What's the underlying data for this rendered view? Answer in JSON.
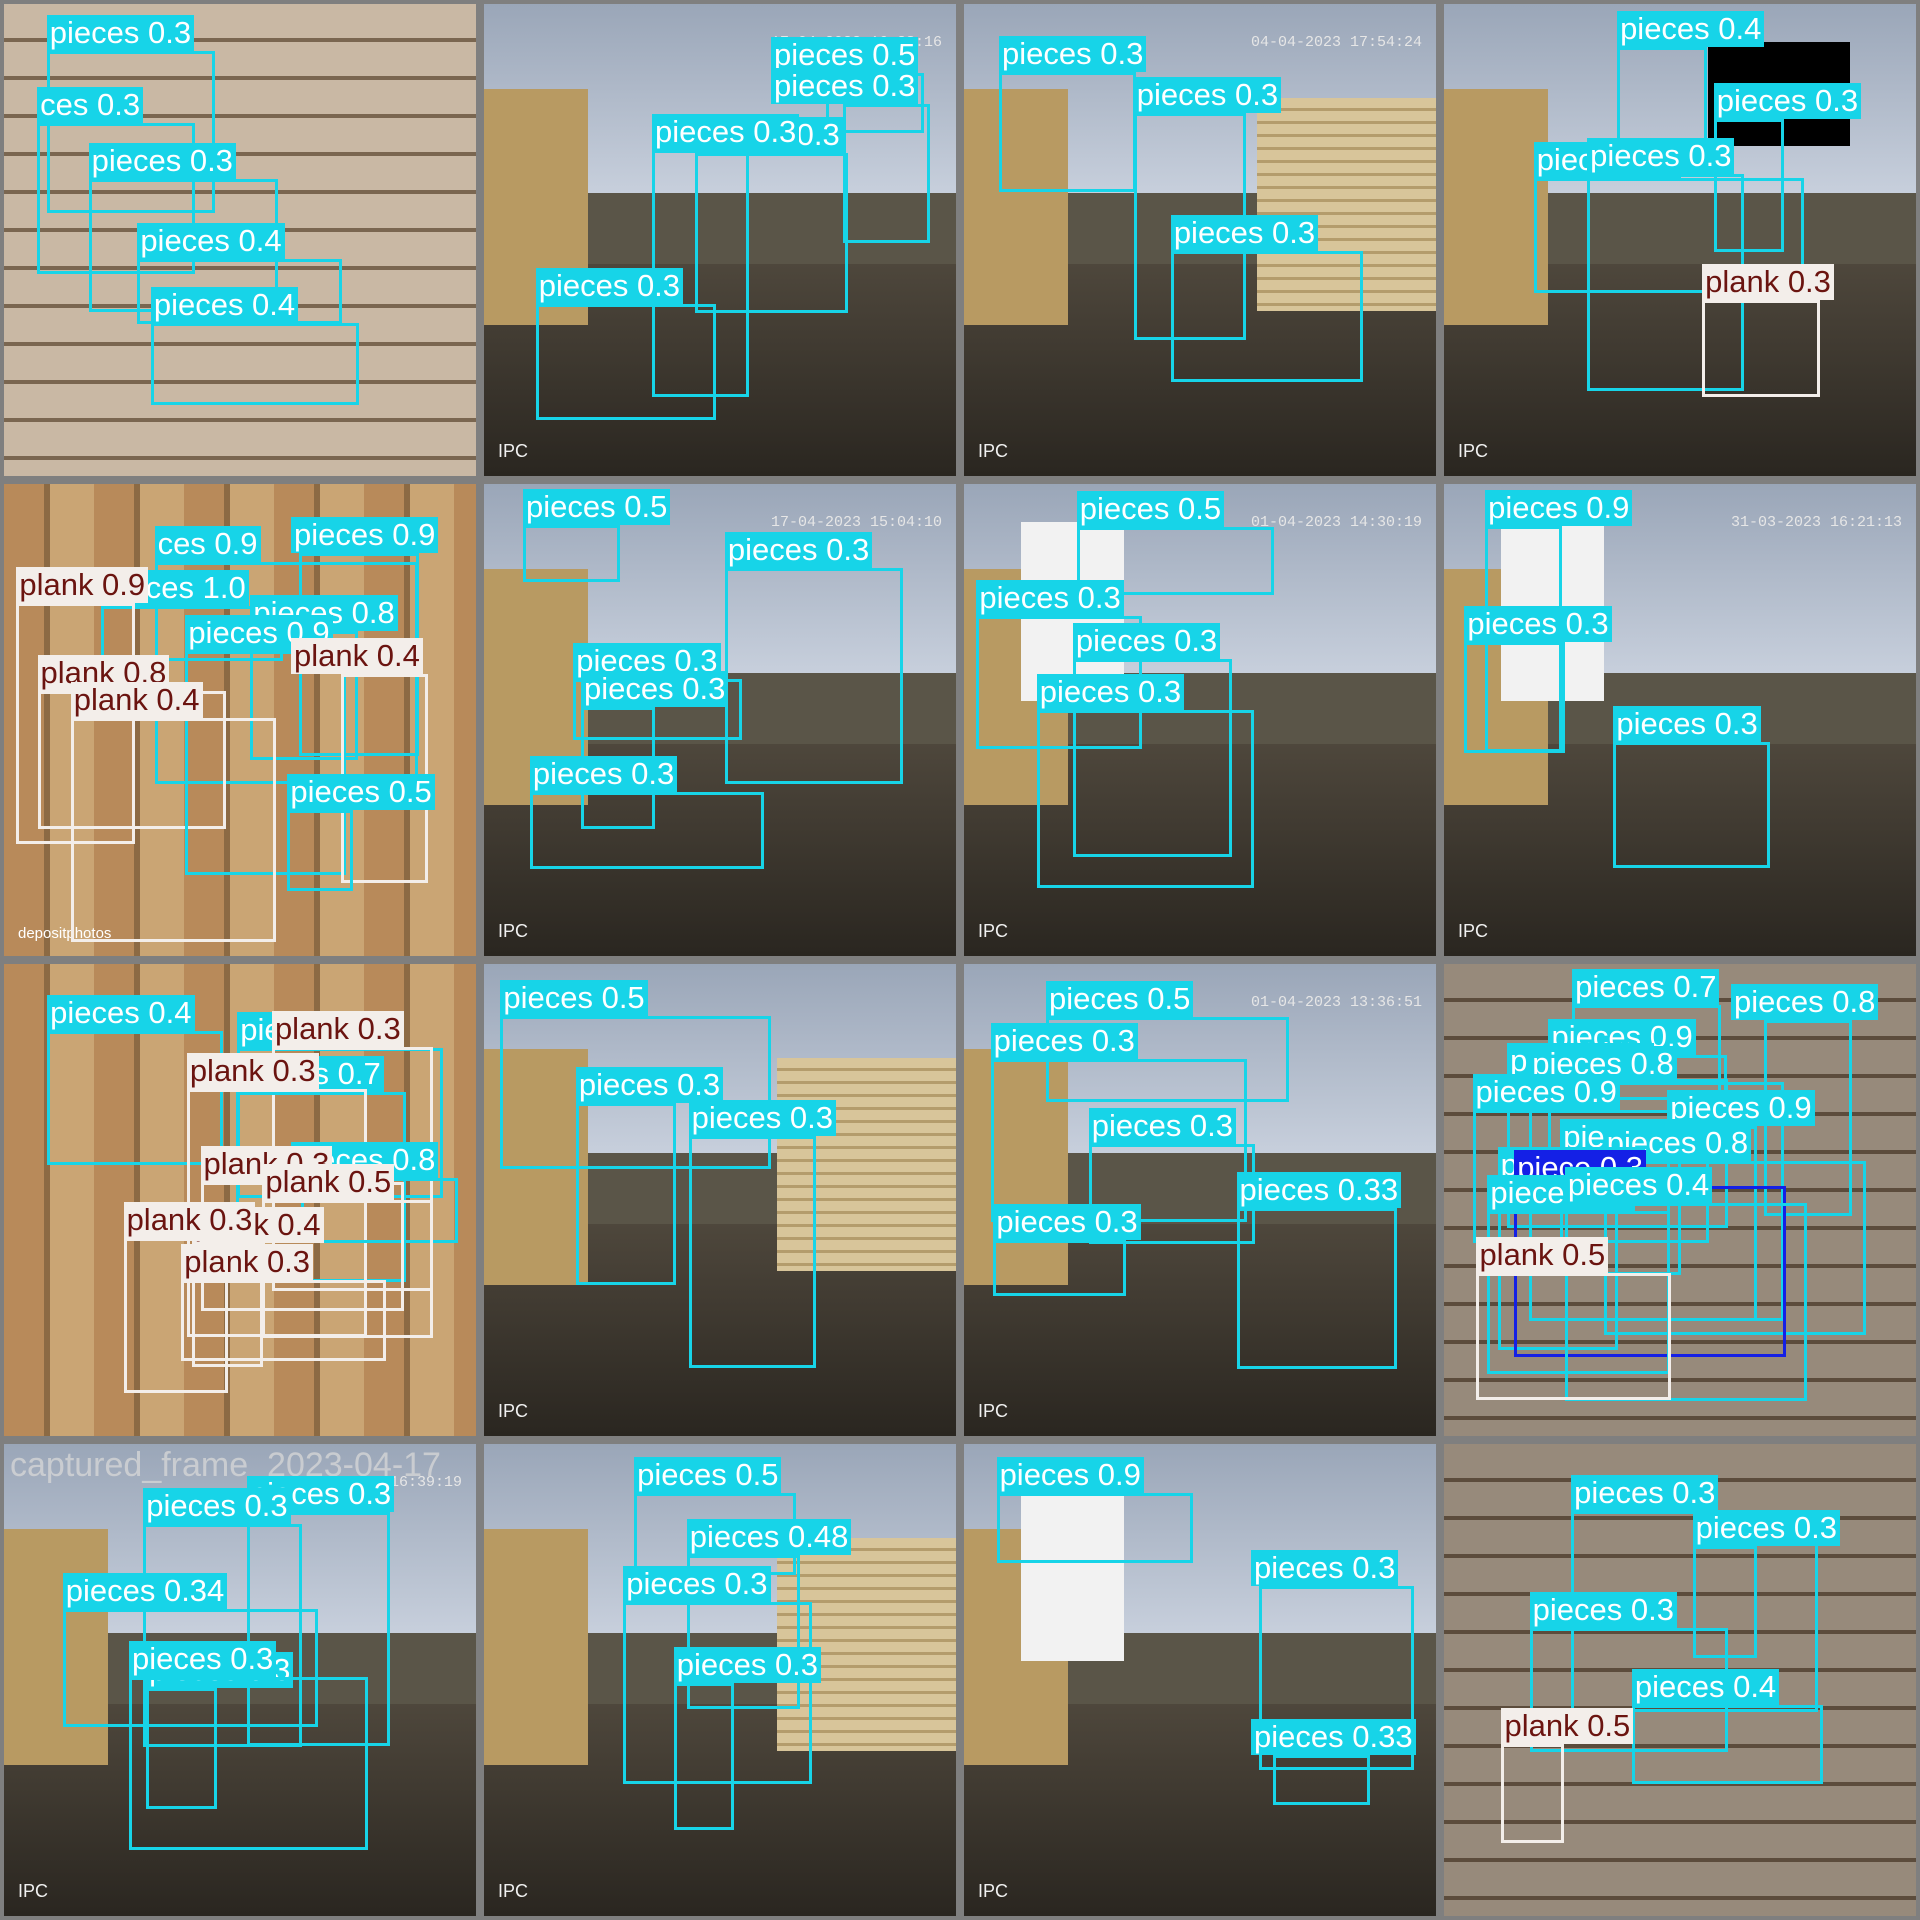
{
  "colors": {
    "pieces": "#17d4e8",
    "plank": "#f3eeea",
    "plank_text": "#6b1410",
    "piece": "#1420e6",
    "pieces_text": "#ffffff"
  },
  "tiles": [
    {
      "scene": "wood2",
      "filename": "",
      "stamp": "",
      "labels": [
        {
          "cls": "pieces",
          "text": "pieces 0.3"
        },
        {
          "cls": "pieces",
          "text": "ces 0.3"
        },
        {
          "cls": "pieces",
          "text": "pieces 0.3"
        },
        {
          "cls": "pieces",
          "text": "pieces 0.4"
        },
        {
          "cls": "pieces",
          "text": "pieces 0.4"
        }
      ]
    },
    {
      "scene": "hall",
      "filename": "",
      "stamp": "17-04-2023 16:38:16",
      "corner": "IPC",
      "labels": [
        {
          "cls": "pieces",
          "text": "pieces 0.5"
        },
        {
          "cls": "pieces",
          "text": "pieces 0.3"
        },
        {
          "cls": "pieces",
          "text": "pieces 0.3"
        },
        {
          "cls": "pieces",
          "text": "pieces 0.3"
        },
        {
          "cls": "pieces",
          "text": "pieces 0.3"
        }
      ]
    },
    {
      "scene": "hall-stack",
      "filename": "",
      "stamp": "04-04-2023 17:54:24",
      "corner": "IPC",
      "labels": [
        {
          "cls": "pieces",
          "text": "pieces 0.3"
        },
        {
          "cls": "pieces",
          "text": "pieces 0.3"
        },
        {
          "cls": "pieces",
          "text": "pieces 0.3"
        }
      ]
    },
    {
      "scene": "hall-black",
      "filename": "",
      "stamp": "",
      "corner": "IPC",
      "labels": [
        {
          "cls": "pieces",
          "text": "pieces 0.4"
        },
        {
          "cls": "pieces",
          "text": "pieces 0.3"
        },
        {
          "cls": "pieces",
          "text": "pieces 0.3"
        },
        {
          "cls": "pieces",
          "text": "pieces 0.3"
        },
        {
          "cls": "plank",
          "text": "plank 0.3"
        }
      ]
    },
    {
      "scene": "wood",
      "filename": "",
      "stamp": "",
      "corner": "depositphotos",
      "labels": [
        {
          "cls": "pieces",
          "text": "pieces 0.9"
        },
        {
          "cls": "pieces",
          "text": "ces 0.9"
        },
        {
          "cls": "pieces",
          "text": "pieces 1.0"
        },
        {
          "cls": "pieces",
          "text": "pieces 0.8"
        },
        {
          "cls": "plank",
          "text": "plank 0.9"
        },
        {
          "cls": "plank",
          "text": "plank 0.8"
        },
        {
          "cls": "pieces",
          "text": "pieces 0.9"
        },
        {
          "cls": "plank",
          "text": "plank 0.4"
        },
        {
          "cls": "pieces",
          "text": "pieces 0.5"
        },
        {
          "cls": "plank",
          "text": "plank 0.4"
        }
      ]
    },
    {
      "scene": "hall",
      "filename": "",
      "stamp": "17-04-2023 15:04:10",
      "corner": "IPC",
      "labels": [
        {
          "cls": "pieces",
          "text": "pieces 0.5"
        },
        {
          "cls": "pieces",
          "text": "pieces 0.3"
        },
        {
          "cls": "pieces",
          "text": "pieces 0.3"
        },
        {
          "cls": "pieces",
          "text": "pieces 0.3"
        },
        {
          "cls": "pieces",
          "text": "pieces 0.3"
        }
      ]
    },
    {
      "scene": "hall-blank",
      "filename": "",
      "stamp": "01-04-2023 14:30:19",
      "corner": "IPC",
      "labels": [
        {
          "cls": "pieces",
          "text": "pieces 0.5"
        },
        {
          "cls": "pieces",
          "text": "pieces 0.3"
        },
        {
          "cls": "pieces",
          "text": "pieces 0.3"
        },
        {
          "cls": "pieces",
          "text": "pieces 0.3"
        }
      ]
    },
    {
      "scene": "hall-blank",
      "filename": "",
      "stamp": "31-03-2023 16:21:13",
      "corner": "IPC",
      "labels": [
        {
          "cls": "pieces",
          "text": "pieces 0.9"
        },
        {
          "cls": "pieces",
          "text": "pieces 0.3"
        },
        {
          "cls": "pieces",
          "text": "pieces 0.3"
        }
      ]
    },
    {
      "scene": "wood",
      "filename": "",
      "stamp": "",
      "labels": [
        {
          "cls": "pieces",
          "text": "pieces 0.4"
        },
        {
          "cls": "pieces",
          "text": "pieces 0.3"
        },
        {
          "cls": "plank",
          "text": "plank 0.3"
        },
        {
          "cls": "pieces",
          "text": "pieces 0.7"
        },
        {
          "cls": "plank",
          "text": "plank 0.3"
        },
        {
          "cls": "pieces",
          "text": "pieces 0.8"
        },
        {
          "cls": "plank",
          "text": "plank 0.3"
        },
        {
          "cls": "plank",
          "text": "plank 0.5"
        },
        {
          "cls": "plank",
          "text": "plank 0.4"
        },
        {
          "cls": "plank",
          "text": "plank 0.3"
        },
        {
          "cls": "plank",
          "text": "plank 0.3"
        }
      ]
    },
    {
      "scene": "hall-stack",
      "filename": "",
      "stamp": "",
      "corner": "IPC",
      "labels": [
        {
          "cls": "pieces",
          "text": "pieces 0.5"
        },
        {
          "cls": "pieces",
          "text": "pieces 0.3"
        },
        {
          "cls": "pieces",
          "text": "pieces 0.3"
        }
      ]
    },
    {
      "scene": "hall",
      "filename": "",
      "stamp": "01-04-2023 13:36:51",
      "corner": "IPC",
      "labels": [
        {
          "cls": "pieces",
          "text": "pieces 0.5"
        },
        {
          "cls": "pieces",
          "text": "pieces 0.3"
        },
        {
          "cls": "pieces",
          "text": "pieces 0.3"
        },
        {
          "cls": "pieces",
          "text": "pieces 0.3"
        },
        {
          "cls": "pieces",
          "text": "pieces 0.33"
        }
      ]
    },
    {
      "scene": "wood-dense",
      "filename": "",
      "stamp": "",
      "labels": [
        {
          "cls": "pieces",
          "text": "pieces 0.7"
        },
        {
          "cls": "pieces",
          "text": "pieces 0.8"
        },
        {
          "cls": "pieces",
          "text": "pieces 0.9"
        },
        {
          "cls": "pieces",
          "text": "pieces 0.9"
        },
        {
          "cls": "pieces",
          "text": "pieces 0.8"
        },
        {
          "cls": "pieces",
          "text": "pieces 0.9"
        },
        {
          "cls": "pieces",
          "text": "pieces 0.9"
        },
        {
          "cls": "pieces",
          "text": "pieces 0.9"
        },
        {
          "cls": "pieces",
          "text": "pieces 0.8"
        },
        {
          "cls": "pieces",
          "text": "pieces 0.7"
        },
        {
          "cls": "piece",
          "text": "piece 0.3"
        },
        {
          "cls": "pieces",
          "text": "pieces 0.3"
        },
        {
          "cls": "pieces",
          "text": "pieces 0.4"
        },
        {
          "cls": "plank",
          "text": "plank 0.5"
        }
      ]
    },
    {
      "scene": "hall",
      "filename": "captured_frame_2023-04-17",
      "stamp": "17-04-2023 16:39:19",
      "corner": "IPC",
      "labels": [
        {
          "cls": "pieces",
          "text": "pieces 0.3"
        },
        {
          "cls": "pieces",
          "text": "pieces 0.3"
        },
        {
          "cls": "pieces",
          "text": "pieces 0.34"
        },
        {
          "cls": "pieces",
          "text": "pieces 0.3"
        },
        {
          "cls": "pieces",
          "text": "pieces 0.3"
        }
      ]
    },
    {
      "scene": "hall-stack",
      "filename": "",
      "stamp": "",
      "corner": "IPC",
      "labels": [
        {
          "cls": "pieces",
          "text": "pieces 0.5"
        },
        {
          "cls": "pieces",
          "text": "pieces 0.48"
        },
        {
          "cls": "pieces",
          "text": "pieces 0.3"
        },
        {
          "cls": "pieces",
          "text": "pieces 0.3"
        }
      ]
    },
    {
      "scene": "hall-blank",
      "filename": "",
      "stamp": "",
      "corner": "IPC",
      "labels": [
        {
          "cls": "pieces",
          "text": "pieces 0.9"
        },
        {
          "cls": "pieces",
          "text": "pieces 0.3"
        },
        {
          "cls": "pieces",
          "text": "pieces 0.33"
        }
      ]
    },
    {
      "scene": "wood-dense",
      "filename": "",
      "stamp": "",
      "labels": [
        {
          "cls": "pieces",
          "text": "pieces 0.3"
        },
        {
          "cls": "pieces",
          "text": "pieces 0.3"
        },
        {
          "cls": "pieces",
          "text": "pieces 0.3"
        },
        {
          "cls": "pieces",
          "text": "pieces 0.4"
        },
        {
          "cls": "plank",
          "text": "plank 0.5"
        }
      ]
    }
  ]
}
